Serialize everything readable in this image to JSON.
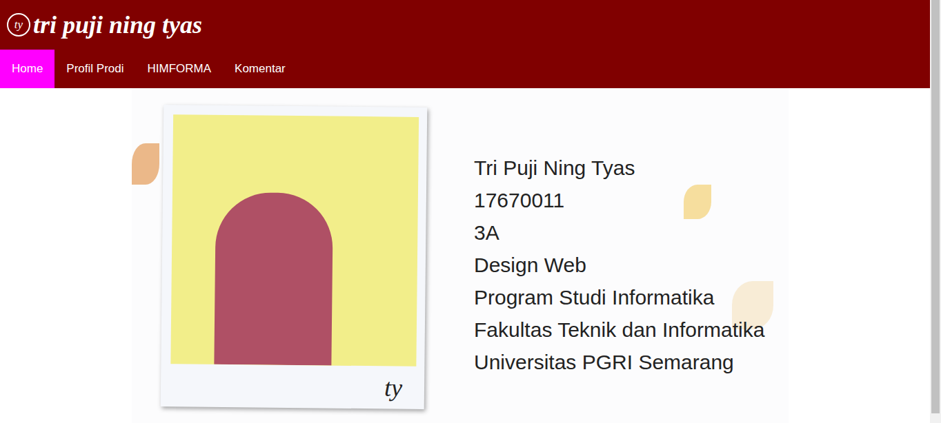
{
  "logo": {
    "icon": "ty",
    "title": "tri puji ning tyas"
  },
  "nav": [
    {
      "label": "Home",
      "selected": true
    },
    {
      "label": "Profil Prodi",
      "selected": false
    },
    {
      "label": "HIMFORMA",
      "selected": false
    },
    {
      "label": "Komentar",
      "selected": false
    }
  ],
  "banner": {
    "signature": "ty",
    "lines": [
      "Tri Puji Ning Tyas",
      "17670011",
      "3A",
      "Design Web",
      "Program Studi Informatika",
      "Fakultas Teknik dan Informatika",
      "Universitas PGRI Semarang"
    ]
  }
}
